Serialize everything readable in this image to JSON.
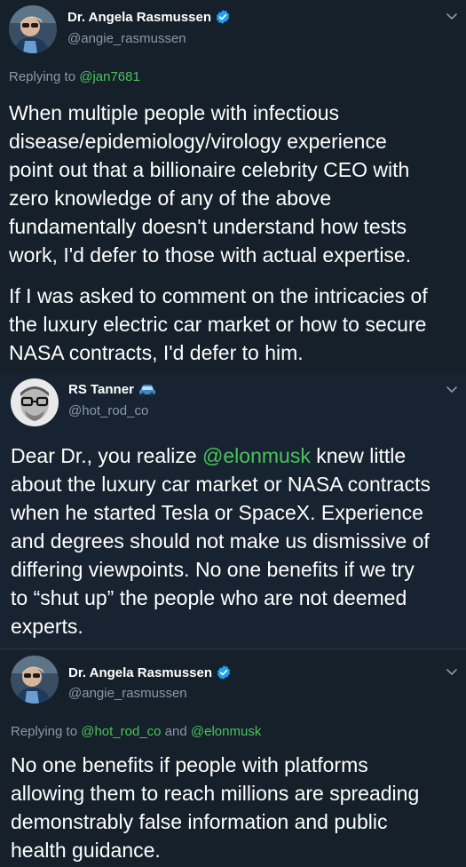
{
  "tweets": [
    {
      "display_name": "Dr. Angela Rasmussen",
      "handle": "@angie_rasmussen",
      "verified": true,
      "reply_prefix": "Replying to",
      "reply_to": "@jan7681",
      "paragraphs": [
        "When multiple people with infectious\ndisease/epidemiology/virology experience\npoint out that a billionaire celebrity CEO with\nzero knowledge of any of the above\nfundamentally doesn't understand how tests\nwork, I'd defer to those with actual expertise.",
        "If I was asked to comment on the intricacies of\nthe luxury electric car market or how to secure\nNASA contracts, I'd defer to him."
      ]
    },
    {
      "display_name": "RS Tanner",
      "handle": "@hot_rod_co",
      "verified": false,
      "name_emoji": "car-emoji",
      "body_before": "Dear Dr., you realize ",
      "body_mention": "@elonmusk",
      "body_after": " knew little\nabout the luxury car market or NASA contracts\nwhen he started Tesla or SpaceX. Experience\nand degrees should not make us dismissive of\ndiffering viewpoints. No one benefits if we try\nto “shut up” the people who are not deemed\nexperts."
    },
    {
      "display_name": "Dr. Angela Rasmussen",
      "handle": "@angie_rasmussen",
      "verified": true,
      "reply_prefix": "Replying to",
      "reply_to_1": "@hot_rod_co",
      "reply_and": "and",
      "reply_to_2": "@elonmusk",
      "body": "No one benefits if people with platforms\nallowing them to reach millions are spreading\ndemonstrably false information and public\nhealth guidance."
    }
  ],
  "colors": {
    "background": "#15202b",
    "secondary_text": "#8899a6",
    "link": "#1da1f2",
    "mention_highlight": "#4cc35a",
    "verified_badge": "#1da1f2"
  },
  "icons": {
    "verified": "verified-badge-icon",
    "chevron": "chevron-down-icon",
    "car": "car-emoji-icon"
  }
}
